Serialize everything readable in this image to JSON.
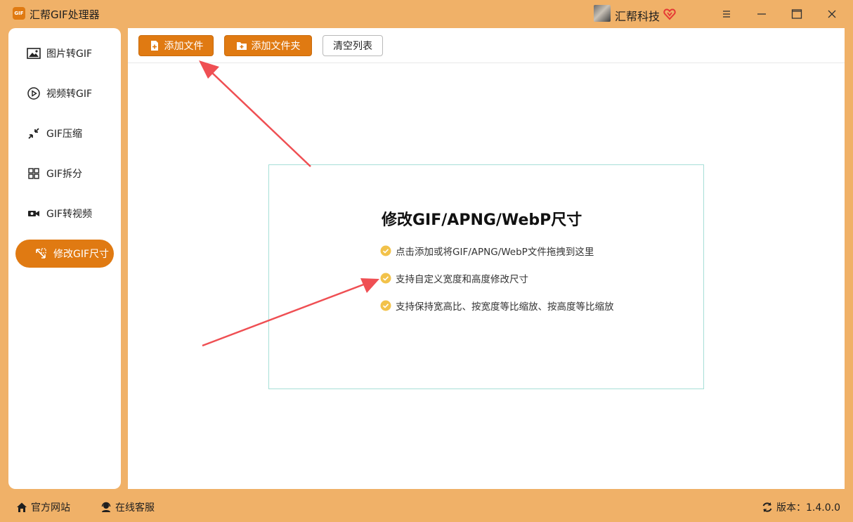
{
  "app": {
    "logo_text": "GIF",
    "title": "汇帮GIF处理器",
    "user_name": "汇帮科技",
    "accent_color": "#e07a12",
    "background_color": "#f0b168"
  },
  "sidebar": {
    "items": [
      {
        "label": "图片转GIF",
        "icon": "image-icon",
        "active": false
      },
      {
        "label": "视频转GIF",
        "icon": "play-circle-icon",
        "active": false
      },
      {
        "label": "GIF压缩",
        "icon": "compress-icon",
        "active": false
      },
      {
        "label": "GIF拆分",
        "icon": "split-icon",
        "active": false
      },
      {
        "label": "GIF转视频",
        "icon": "video-camera-icon",
        "active": false
      },
      {
        "label": "修改GIF尺寸",
        "icon": "resize-icon",
        "active": true
      }
    ]
  },
  "toolbar": {
    "add_file_label": "添加文件",
    "add_folder_label": "添加文件夹",
    "clear_list_label": "清空列表"
  },
  "drop_zone": {
    "title": "修改GIF/APNG/WebP尺寸",
    "tips": [
      "点击添加或将GIF/APNG/WebP文件拖拽到这里",
      "支持自定义宽度和高度修改尺寸",
      "支持保持宽高比、按宽度等比缩放、按高度等比缩放"
    ]
  },
  "footer": {
    "website_label": "官方网站",
    "support_label": "在线客服",
    "version_label": "版本：1.4.0.0"
  }
}
